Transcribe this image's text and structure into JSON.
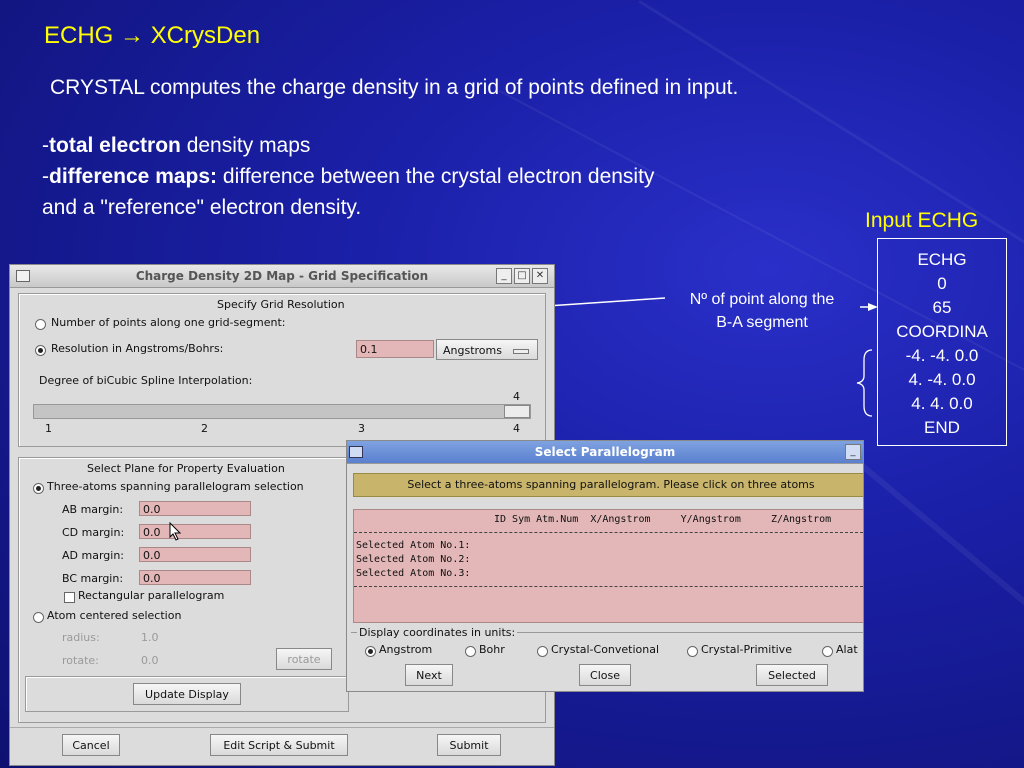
{
  "slide": {
    "title": "ECHG → XCrysDen",
    "subtitle": "CRYSTAL computes the charge density in a grid of points defined in input.",
    "bullet1_dash": "-",
    "bullet1_bold": "total electron",
    "bullet1_rest": " density maps",
    "bullet2_dash": "-",
    "bullet2_bold": "difference maps:",
    "bullet2_rest": " difference between the crystal electron density",
    "bullet2_cont": "and a \"reference\" electron density.",
    "input_title": "Input ECHG",
    "input_lines": [
      "ECHG",
      "0",
      "65",
      "COORDINA",
      "-4. -4. 0.0",
      "4. -4. 0.0",
      "4. 4. 0.0",
      "END"
    ],
    "annotation_line1": "Nº of point along the",
    "annotation_line2": "B-A segment"
  },
  "grid_window": {
    "title": "Charge Density 2D Map - Grid Specification",
    "section1_title": "Specify Grid Resolution",
    "radio_points": "Number of points along one grid-segment:",
    "radio_resolution": "Resolution in Angstroms/Bohrs:",
    "resolution_value": "0.1",
    "units_select": "Angstroms",
    "spline_label": "Degree of biCubic Spline Interpolation:",
    "slider_value": "4",
    "slider_ticks": [
      "1",
      "2",
      "3",
      "4"
    ],
    "section2_title": "Select Plane for Property Evaluation",
    "radio_three_atoms": "Three-atoms spanning parallelogram selection",
    "ab_label": "AB margin:",
    "ab_value": "0.0",
    "cd_label": "CD margin:",
    "cd_value": "0.0",
    "ad_label": "AD margin:",
    "ad_value": "0.0",
    "bc_label": "BC margin:",
    "bc_value": "0.0",
    "rect_label": "Rectangular parallelogram",
    "radio_atom_centered": "Atom centered selection",
    "radius_label": "radius:",
    "radius_value": "1.0",
    "rotate_label": "rotate:",
    "rotate_value": "0.0",
    "rotate_button": "rotate",
    "update_button": "Update Display",
    "cancel_button": "Cancel",
    "edit_button": "Edit Script & Submit",
    "submit_button": "Submit"
  },
  "parallelogram_window": {
    "title": "Select Parallelogram",
    "banner": "Select a three-atoms spanning parallelogram. Please click on three atoms",
    "table_header": "ID Sym Atm.Num  X/Angstrom     Y/Angstrom     Z/Angstrom",
    "atom1": "Selected Atom No.1:",
    "atom2": "Selected Atom No.2:",
    "atom3": "Selected Atom No.3:",
    "units_legend": "Display coordinates in units:",
    "units": [
      "Angstrom",
      "Bohr",
      "Crystal-Convetional",
      "Crystal-Primitive",
      "Alat"
    ],
    "next_button": "Next",
    "close_button": "Close",
    "selected_button": "Selected"
  }
}
